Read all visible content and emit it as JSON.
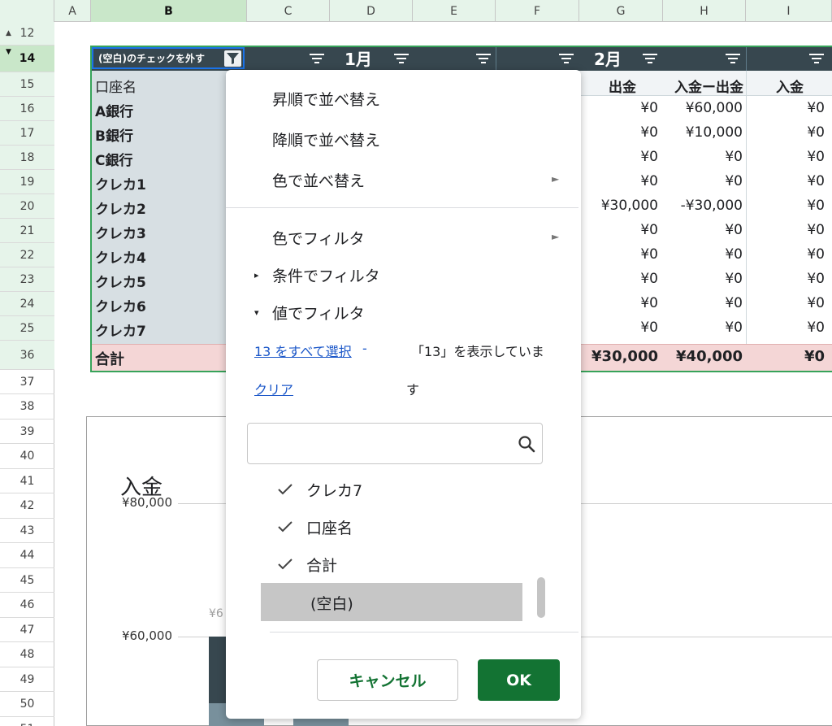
{
  "column_headers": [
    "A",
    "B",
    "C",
    "D",
    "E",
    "F",
    "G",
    "H",
    "I"
  ],
  "row_headers": [
    "12",
    "14",
    "15",
    "16",
    "17",
    "18",
    "19",
    "20",
    "21",
    "22",
    "23",
    "24",
    "25",
    "36",
    "37",
    "38",
    "39",
    "40",
    "41",
    "42",
    "43",
    "44",
    "45",
    "46",
    "47",
    "48",
    "49",
    "50",
    "51"
  ],
  "pivot": {
    "filter_chip_label": "(空白)のチェックを外す",
    "months": [
      "1月",
      "2月"
    ],
    "row_label_header": "口座名",
    "value_headers": [
      "出金",
      "入金ー出金",
      "入金"
    ],
    "rows": [
      {
        "label": "A銀行",
        "out": "¥0",
        "net": "¥60,000",
        "in": "¥0"
      },
      {
        "label": "B銀行",
        "out": "¥0",
        "net": "¥10,000",
        "in": "¥0"
      },
      {
        "label": "C銀行",
        "out": "¥0",
        "net": "¥0",
        "in": "¥0"
      },
      {
        "label": "クレカ1",
        "out": "¥0",
        "net": "¥0",
        "in": "¥0"
      },
      {
        "label": "クレカ2",
        "out": "¥30,000",
        "net": "-¥30,000",
        "in": "¥0"
      },
      {
        "label": "クレカ3",
        "out": "¥0",
        "net": "¥0",
        "in": "¥0"
      },
      {
        "label": "クレカ4",
        "out": "¥0",
        "net": "¥0",
        "in": "¥0"
      },
      {
        "label": "クレカ5",
        "out": "¥0",
        "net": "¥0",
        "in": "¥0"
      },
      {
        "label": "クレカ6",
        "out": "¥0",
        "net": "¥0",
        "in": "¥0"
      },
      {
        "label": "クレカ7",
        "out": "¥0",
        "net": "¥0",
        "in": "¥0"
      }
    ],
    "total": {
      "label": "合計",
      "out": "¥30,000",
      "net": "¥40,000",
      "in": "¥0"
    }
  },
  "chart": {
    "title": "入金",
    "y_ticks": [
      "¥80,000",
      "¥60,000"
    ],
    "data_label_partial": "¥6"
  },
  "filter_menu": {
    "sort_asc": "昇順で並べ替え",
    "sort_desc": "降順で並べ替え",
    "sort_by_color": "色で並べ替え",
    "filter_by_color": "色でフィルタ",
    "filter_by_condition": "条件でフィルタ",
    "filter_by_values": "値でフィルタ",
    "select_all": "13 をすべて選択",
    "select_all_sep": "-",
    "clear": "クリア",
    "status_line1": "「13」を表示していま",
    "status_line2": "す",
    "search_value": "",
    "options": [
      {
        "label": "クレカ7",
        "checked": true
      },
      {
        "label": "口座名",
        "checked": true
      },
      {
        "label": "合計",
        "checked": true
      },
      {
        "label": "(空白)",
        "checked": false
      }
    ],
    "cancel_label": "キャンセル",
    "ok_label": "OK"
  },
  "colors": {
    "header_green": "#e6f4ea",
    "pivot_dark": "#37474f",
    "total_pink": "#f4d6d6",
    "ok_green": "#137333",
    "link_blue": "#1a56c8"
  },
  "icons": {
    "filter_active": "funnel-icon",
    "filter_menu": "filter-lines-icon",
    "search": "magnifier-icon",
    "check": "checkmark-icon",
    "submenu": "triangle-right-icon"
  }
}
